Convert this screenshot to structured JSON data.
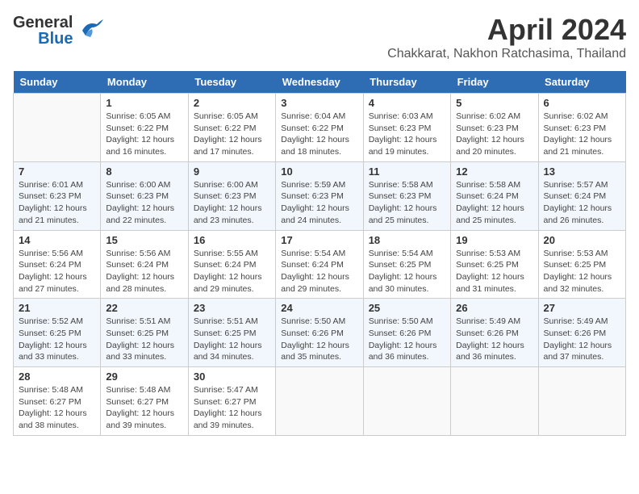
{
  "header": {
    "logo_line1": "General",
    "logo_line2": "Blue",
    "month_title": "April 2024",
    "location": "Chakkarat, Nakhon Ratchasima, Thailand"
  },
  "calendar": {
    "weekdays": [
      "Sunday",
      "Monday",
      "Tuesday",
      "Wednesday",
      "Thursday",
      "Friday",
      "Saturday"
    ],
    "weeks": [
      [
        {
          "day": "",
          "info": ""
        },
        {
          "day": "1",
          "info": "Sunrise: 6:05 AM\nSunset: 6:22 PM\nDaylight: 12 hours\nand 16 minutes."
        },
        {
          "day": "2",
          "info": "Sunrise: 6:05 AM\nSunset: 6:22 PM\nDaylight: 12 hours\nand 17 minutes."
        },
        {
          "day": "3",
          "info": "Sunrise: 6:04 AM\nSunset: 6:22 PM\nDaylight: 12 hours\nand 18 minutes."
        },
        {
          "day": "4",
          "info": "Sunrise: 6:03 AM\nSunset: 6:23 PM\nDaylight: 12 hours\nand 19 minutes."
        },
        {
          "day": "5",
          "info": "Sunrise: 6:02 AM\nSunset: 6:23 PM\nDaylight: 12 hours\nand 20 minutes."
        },
        {
          "day": "6",
          "info": "Sunrise: 6:02 AM\nSunset: 6:23 PM\nDaylight: 12 hours\nand 21 minutes."
        }
      ],
      [
        {
          "day": "7",
          "info": "Sunrise: 6:01 AM\nSunset: 6:23 PM\nDaylight: 12 hours\nand 21 minutes."
        },
        {
          "day": "8",
          "info": "Sunrise: 6:00 AM\nSunset: 6:23 PM\nDaylight: 12 hours\nand 22 minutes."
        },
        {
          "day": "9",
          "info": "Sunrise: 6:00 AM\nSunset: 6:23 PM\nDaylight: 12 hours\nand 23 minutes."
        },
        {
          "day": "10",
          "info": "Sunrise: 5:59 AM\nSunset: 6:23 PM\nDaylight: 12 hours\nand 24 minutes."
        },
        {
          "day": "11",
          "info": "Sunrise: 5:58 AM\nSunset: 6:23 PM\nDaylight: 12 hours\nand 25 minutes."
        },
        {
          "day": "12",
          "info": "Sunrise: 5:58 AM\nSunset: 6:24 PM\nDaylight: 12 hours\nand 25 minutes."
        },
        {
          "day": "13",
          "info": "Sunrise: 5:57 AM\nSunset: 6:24 PM\nDaylight: 12 hours\nand 26 minutes."
        }
      ],
      [
        {
          "day": "14",
          "info": "Sunrise: 5:56 AM\nSunset: 6:24 PM\nDaylight: 12 hours\nand 27 minutes."
        },
        {
          "day": "15",
          "info": "Sunrise: 5:56 AM\nSunset: 6:24 PM\nDaylight: 12 hours\nand 28 minutes."
        },
        {
          "day": "16",
          "info": "Sunrise: 5:55 AM\nSunset: 6:24 PM\nDaylight: 12 hours\nand 29 minutes."
        },
        {
          "day": "17",
          "info": "Sunrise: 5:54 AM\nSunset: 6:24 PM\nDaylight: 12 hours\nand 29 minutes."
        },
        {
          "day": "18",
          "info": "Sunrise: 5:54 AM\nSunset: 6:25 PM\nDaylight: 12 hours\nand 30 minutes."
        },
        {
          "day": "19",
          "info": "Sunrise: 5:53 AM\nSunset: 6:25 PM\nDaylight: 12 hours\nand 31 minutes."
        },
        {
          "day": "20",
          "info": "Sunrise: 5:53 AM\nSunset: 6:25 PM\nDaylight: 12 hours\nand 32 minutes."
        }
      ],
      [
        {
          "day": "21",
          "info": "Sunrise: 5:52 AM\nSunset: 6:25 PM\nDaylight: 12 hours\nand 33 minutes."
        },
        {
          "day": "22",
          "info": "Sunrise: 5:51 AM\nSunset: 6:25 PM\nDaylight: 12 hours\nand 33 minutes."
        },
        {
          "day": "23",
          "info": "Sunrise: 5:51 AM\nSunset: 6:25 PM\nDaylight: 12 hours\nand 34 minutes."
        },
        {
          "day": "24",
          "info": "Sunrise: 5:50 AM\nSunset: 6:26 PM\nDaylight: 12 hours\nand 35 minutes."
        },
        {
          "day": "25",
          "info": "Sunrise: 5:50 AM\nSunset: 6:26 PM\nDaylight: 12 hours\nand 36 minutes."
        },
        {
          "day": "26",
          "info": "Sunrise: 5:49 AM\nSunset: 6:26 PM\nDaylight: 12 hours\nand 36 minutes."
        },
        {
          "day": "27",
          "info": "Sunrise: 5:49 AM\nSunset: 6:26 PM\nDaylight: 12 hours\nand 37 minutes."
        }
      ],
      [
        {
          "day": "28",
          "info": "Sunrise: 5:48 AM\nSunset: 6:27 PM\nDaylight: 12 hours\nand 38 minutes."
        },
        {
          "day": "29",
          "info": "Sunrise: 5:48 AM\nSunset: 6:27 PM\nDaylight: 12 hours\nand 39 minutes."
        },
        {
          "day": "30",
          "info": "Sunrise: 5:47 AM\nSunset: 6:27 PM\nDaylight: 12 hours\nand 39 minutes."
        },
        {
          "day": "",
          "info": ""
        },
        {
          "day": "",
          "info": ""
        },
        {
          "day": "",
          "info": ""
        },
        {
          "day": "",
          "info": ""
        }
      ]
    ]
  }
}
